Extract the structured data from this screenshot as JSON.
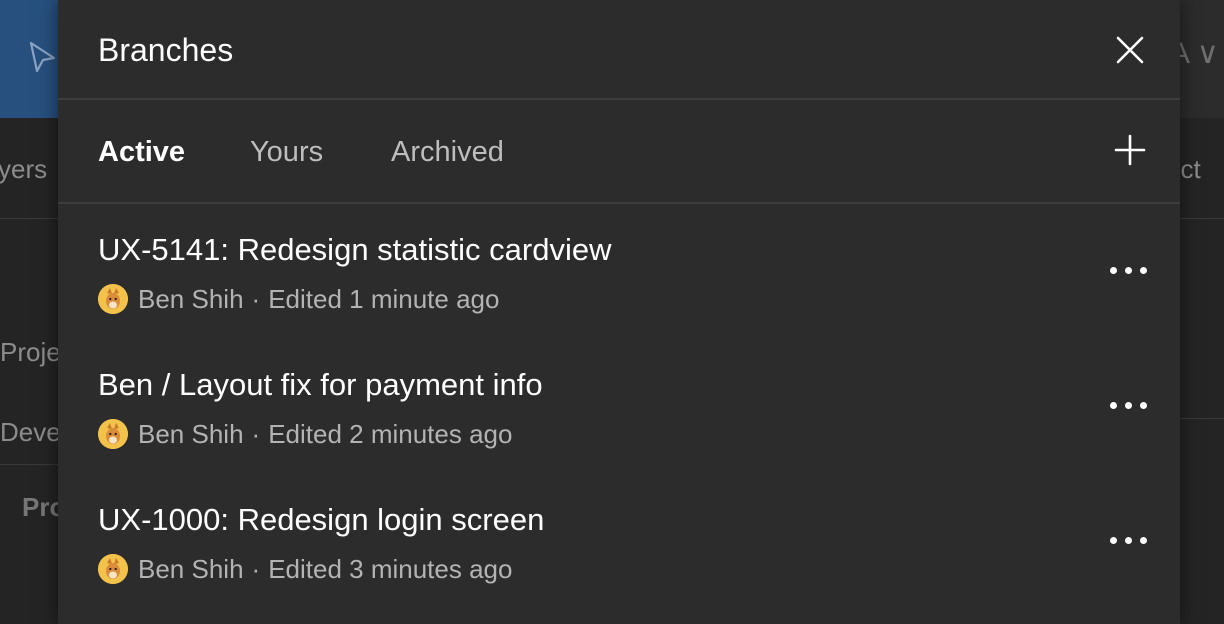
{
  "background": {
    "left_labels": [
      "yers",
      "Proje",
      "Deve",
      "Pro"
    ],
    "right_labels": [
      "ect"
    ],
    "right_header_glyphs": "A ∨"
  },
  "modal": {
    "title": "Branches",
    "close_icon": "close-icon",
    "tabs": [
      {
        "label": "Active",
        "active": true
      },
      {
        "label": "Yours",
        "active": false
      },
      {
        "label": "Archived",
        "active": false
      }
    ],
    "add_icon": "plus-icon",
    "branches": [
      {
        "title": "UX-5141: Redesign statistic cardview",
        "author": "Ben Shih",
        "separator": "·",
        "edited": "Edited 1 minute ago"
      },
      {
        "title": "Ben / Layout fix for payment info",
        "author": "Ben Shih",
        "separator": "·",
        "edited": "Edited 2 minutes ago"
      },
      {
        "title": "UX-1000: Redesign login screen",
        "author": "Ben Shih",
        "separator": "·",
        "edited": "Edited 3 minutes ago"
      }
    ]
  },
  "colors": {
    "modal_bg": "#2c2c2c",
    "divider": "#3d3d3d",
    "text_primary": "#ffffff",
    "text_secondary": "#b3b3b3",
    "tool_active": "#27507f",
    "avatar": "#f3c24a"
  }
}
